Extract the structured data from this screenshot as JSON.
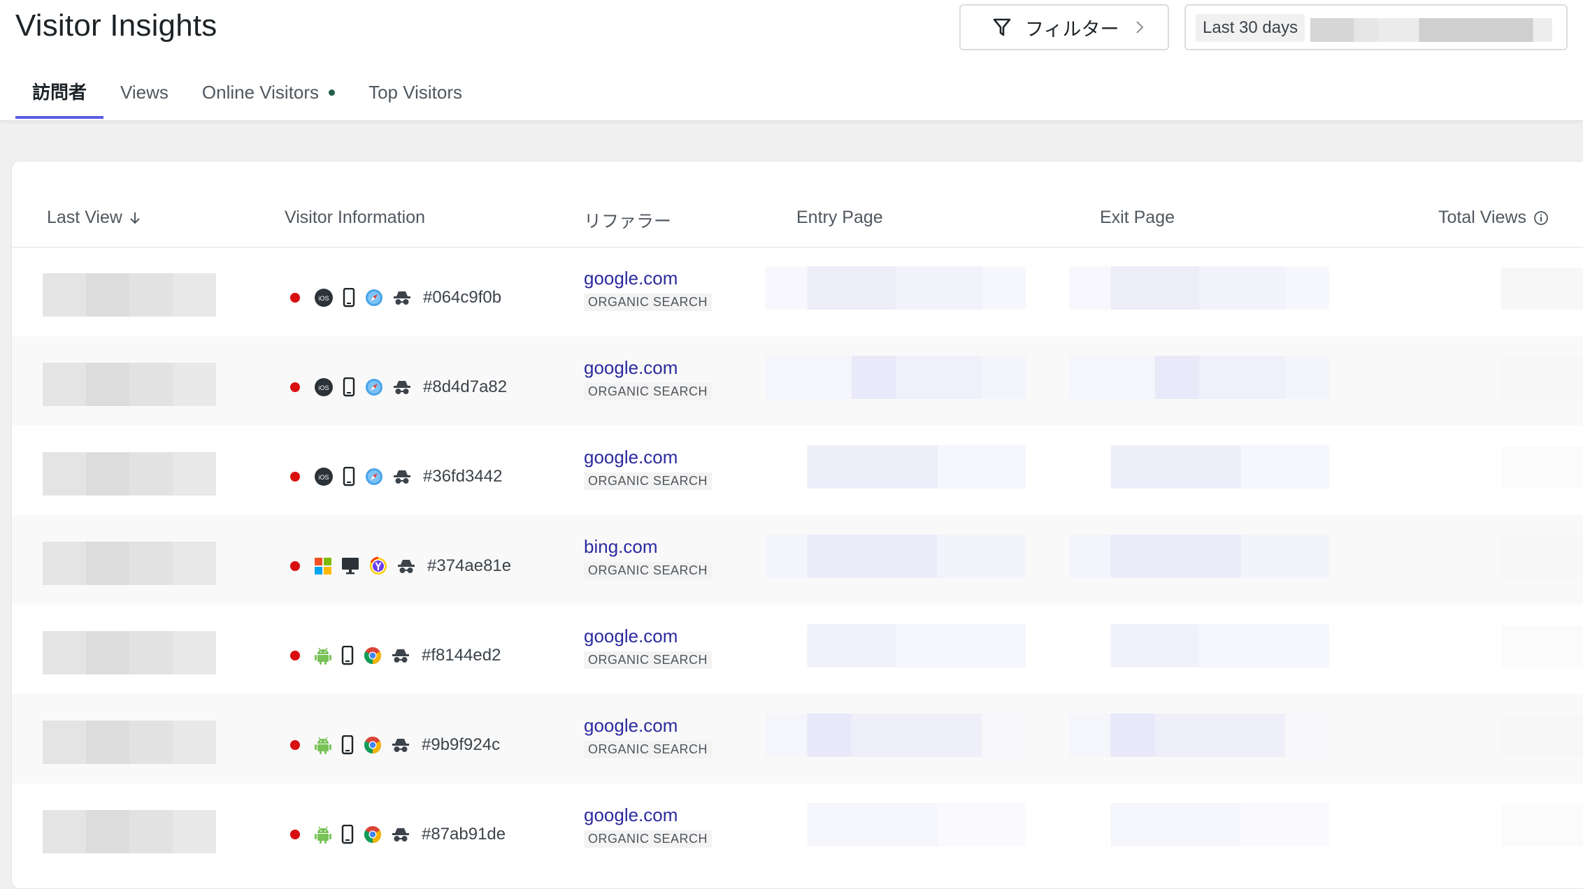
{
  "header": {
    "title": "Visitor Insights",
    "filter_label": "フィルター",
    "date_range_label": "Last 30 days"
  },
  "tabs": [
    {
      "label": "訪問者",
      "active": true
    },
    {
      "label": "Views",
      "active": false
    },
    {
      "label": "Online Visitors",
      "active": false,
      "indicator": "online-dot"
    },
    {
      "label": "Top Visitors",
      "active": false
    }
  ],
  "table": {
    "columns": [
      "Last View",
      "Visitor Information",
      "リファラー",
      "Entry Page",
      "Exit Page",
      "Total Views"
    ],
    "rows": [
      {
        "os": "ios-icon",
        "device": "mobile-icon",
        "browser": "safari-icon",
        "visitor_id": "#064c9f0b",
        "referrer": "google.com",
        "referrer_type": "ORGANIC SEARCH"
      },
      {
        "os": "ios-icon",
        "device": "mobile-icon",
        "browser": "safari-icon",
        "visitor_id": "#8d4d7a82",
        "referrer": "google.com",
        "referrer_type": "ORGANIC SEARCH"
      },
      {
        "os": "ios-icon",
        "device": "mobile-icon",
        "browser": "safari-icon",
        "visitor_id": "#36fd3442",
        "referrer": "google.com",
        "referrer_type": "ORGANIC SEARCH"
      },
      {
        "os": "windows-icon",
        "device": "desktop-icon",
        "browser": "yandex-icon",
        "visitor_id": "#374ae81e",
        "referrer": "bing.com",
        "referrer_type": "ORGANIC SEARCH"
      },
      {
        "os": "android-icon",
        "device": "mobile-icon",
        "browser": "chrome-icon",
        "visitor_id": "#f8144ed2",
        "referrer": "google.com",
        "referrer_type": "ORGANIC SEARCH"
      },
      {
        "os": "android-icon",
        "device": "mobile-icon",
        "browser": "chrome-icon",
        "visitor_id": "#9b9f924c",
        "referrer": "google.com",
        "referrer_type": "ORGANIC SEARCH"
      },
      {
        "os": "android-icon",
        "device": "mobile-icon",
        "browser": "chrome-icon",
        "visitor_id": "#87ab91de",
        "referrer": "google.com",
        "referrer_type": "ORGANIC SEARCH"
      }
    ]
  },
  "colors": {
    "accent": "#5b5be0",
    "link": "#2a2a9f",
    "status_dot": "#d90f0f",
    "online_dot": "#1f5f4a"
  }
}
